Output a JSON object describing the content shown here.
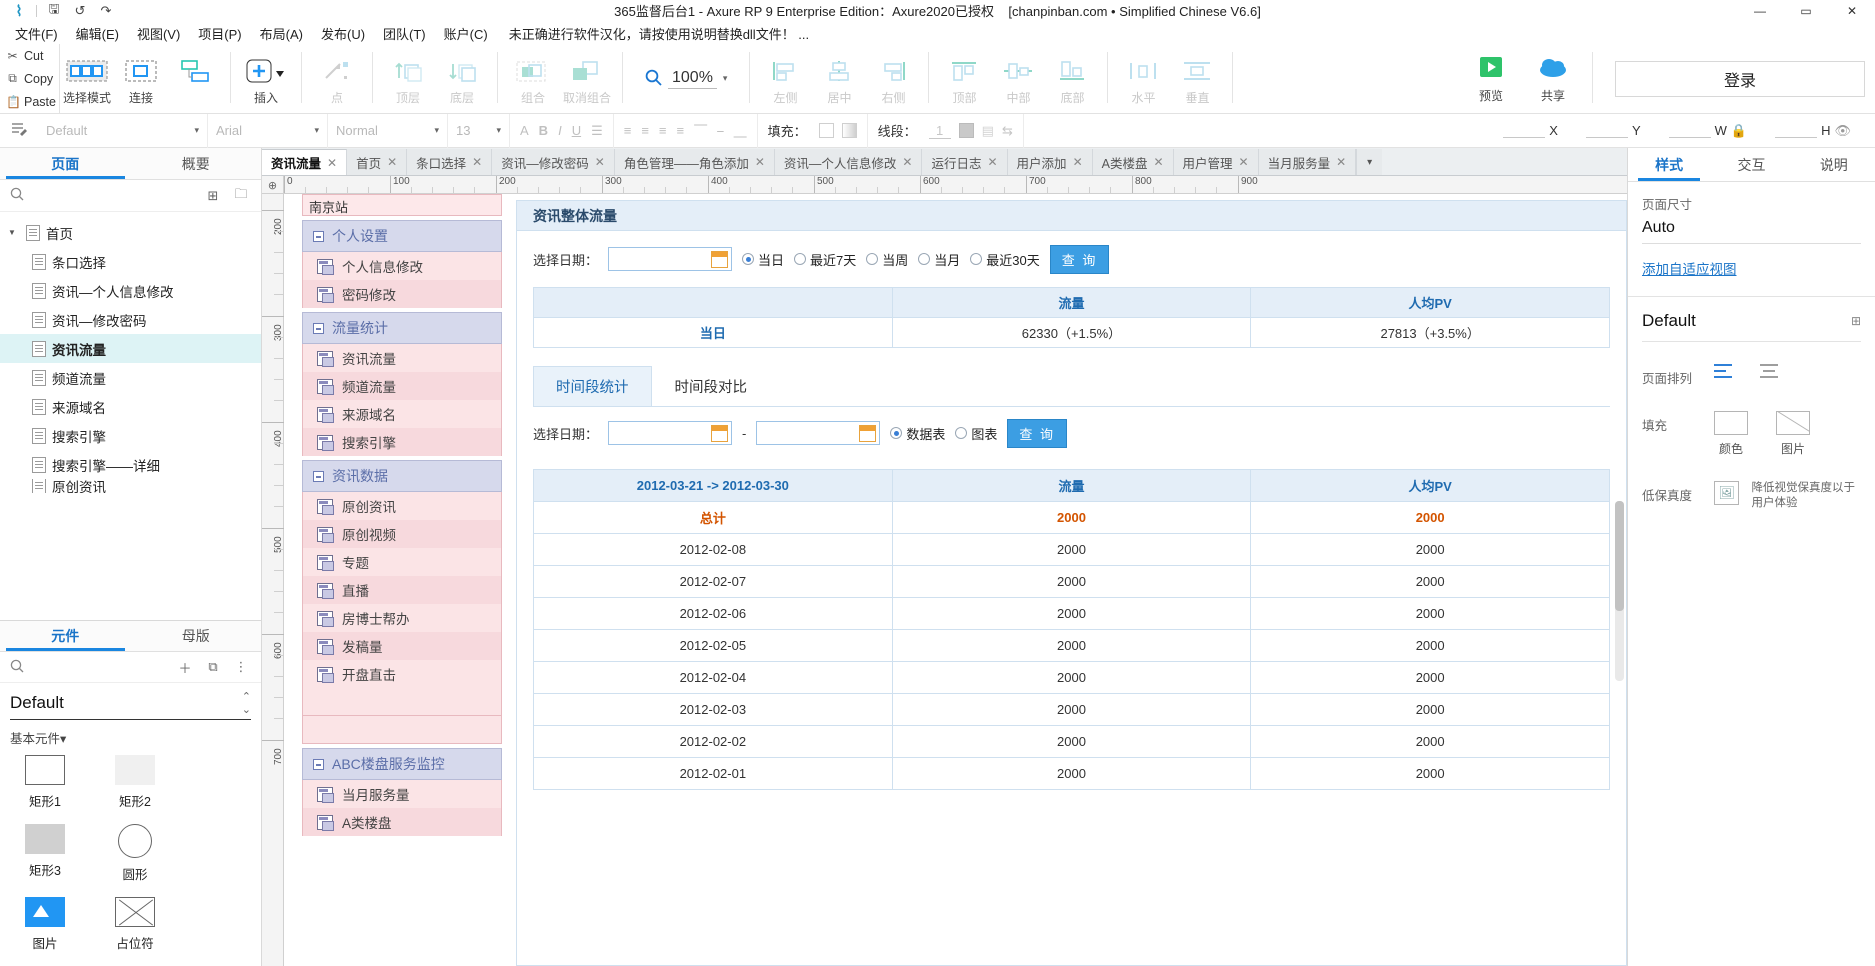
{
  "titlebar": {
    "title": "365监督后台1 - Axure RP 9 Enterprise Edition：Axure2020已授权",
    "subtitle": "[chanpinban.com • Simplified Chinese V6.6]",
    "minimize": "—",
    "maximize": "▭",
    "close": "✕",
    "icons": [
      "logo-x",
      "save-icon",
      "undo-icon",
      "redo-icon"
    ]
  },
  "menubar": {
    "items": [
      "文件(F)",
      "编辑(E)",
      "视图(V)",
      "项目(P)",
      "布局(A)",
      "发布(U)",
      "团队(T)",
      "账户(C)"
    ],
    "note": "未正确进行软件汉化，请按使用说明替换dll文件！ ..."
  },
  "clipboard": {
    "cut": "Cut",
    "copy": "Copy",
    "paste": "Paste"
  },
  "toolbar": {
    "items": [
      {
        "label": "选择模式",
        "name": "select-mode"
      },
      {
        "label": "连接",
        "name": "connect"
      },
      {
        "label": "插入",
        "name": "insert"
      },
      {
        "label": "点",
        "name": "point"
      },
      {
        "label": "顶层",
        "name": "bring-front"
      },
      {
        "label": "底层",
        "name": "send-back"
      },
      {
        "label": "组合",
        "name": "group"
      },
      {
        "label": "取消组合",
        "name": "ungroup"
      },
      {
        "label": "左侧",
        "name": "align-left"
      },
      {
        "label": "居中",
        "name": "align-center"
      },
      {
        "label": "右侧",
        "name": "align-right"
      },
      {
        "label": "顶部",
        "name": "align-top"
      },
      {
        "label": "中部",
        "name": "align-middle"
      },
      {
        "label": "底部",
        "name": "align-bottom"
      },
      {
        "label": "水平",
        "name": "distribute-horizontal"
      },
      {
        "label": "垂直",
        "name": "distribute-vertical"
      }
    ],
    "zoom": "100%",
    "preview": "预览",
    "share": "共享",
    "login": "登录"
  },
  "formatbar": {
    "style": "Default",
    "font": "Arial",
    "weight": "Normal",
    "size": "13",
    "fill_label": "填充：",
    "line_label": "线段：",
    "line_width": "1",
    "x_label": "X",
    "y_label": "Y",
    "w_label": "W",
    "h_label": "H"
  },
  "left_panel": {
    "tabs": [
      {
        "label": "页面",
        "active": true
      },
      {
        "label": "概要",
        "active": false
      }
    ],
    "search_placeholder": "",
    "tree": [
      {
        "label": "首页",
        "level": 0,
        "expanded": true,
        "selected": false
      },
      {
        "label": "条口选择",
        "level": 1,
        "selected": false
      },
      {
        "label": "资讯—个人信息修改",
        "level": 1,
        "selected": false
      },
      {
        "label": "资讯—修改密码",
        "level": 1,
        "selected": false
      },
      {
        "label": "资讯流量",
        "level": 1,
        "selected": true
      },
      {
        "label": "频道流量",
        "level": 1,
        "selected": false
      },
      {
        "label": "来源域名",
        "level": 1,
        "selected": false
      },
      {
        "label": "搜索引擎",
        "level": 1,
        "selected": false
      },
      {
        "label": "搜索引擎——详细",
        "level": 1,
        "selected": false
      },
      {
        "label": "原创资讯",
        "level": 1,
        "selected": false
      }
    ]
  },
  "library_panel": {
    "tabs": [
      {
        "label": "元件",
        "active": true
      },
      {
        "label": "母版",
        "active": false
      }
    ],
    "selected_library": "Default",
    "category": "基本元件",
    "items": [
      {
        "label": "矩形1",
        "shape": "rect-outline"
      },
      {
        "label": "矩形2",
        "shape": "rect-light"
      },
      {
        "label": "矩形3",
        "shape": "rect-gray"
      },
      {
        "label": "圆形",
        "shape": "circle"
      },
      {
        "label": "图片",
        "shape": "image"
      },
      {
        "label": "占位符",
        "shape": "placeholder"
      }
    ]
  },
  "tabbar": {
    "tabs": [
      {
        "label": "资讯流量",
        "active": true
      },
      {
        "label": "首页",
        "active": false
      },
      {
        "label": "条口选择",
        "active": false
      },
      {
        "label": "资讯—修改密码",
        "active": false
      },
      {
        "label": "角色管理——角色添加",
        "active": false
      },
      {
        "label": "资讯—个人信息修改",
        "active": false
      },
      {
        "label": "运行日志",
        "active": false
      },
      {
        "label": "用户添加",
        "active": false
      },
      {
        "label": "A类楼盘",
        "active": false
      },
      {
        "label": "用户管理",
        "active": false
      },
      {
        "label": "当月服务量",
        "active": false
      }
    ],
    "more": "▾"
  },
  "rulers": {
    "horizontal": [
      "0",
      "100",
      "200",
      "300",
      "400",
      "500",
      "600",
      "700",
      "800",
      "900"
    ],
    "vertical": [
      "200",
      "300",
      "400",
      "500",
      "600",
      "700"
    ]
  },
  "prototype_nav": {
    "site_label": "南京站",
    "groups": [
      {
        "title": "个人设置",
        "items": [
          "个人信息修改",
          "密码修改"
        ]
      },
      {
        "title": "流量统计",
        "items": [
          "资讯流量",
          "频道流量",
          "来源域名",
          "搜索引擎"
        ]
      },
      {
        "title": "资讯数据",
        "items": [
          "原创资讯",
          "原创视频",
          "专题",
          "直播",
          "房博士帮办",
          "发稿量",
          "开盘直击"
        ]
      },
      {
        "title": "ABC楼盘服务监控",
        "items": [
          "当月服务量",
          "A类楼盘"
        ]
      }
    ]
  },
  "report": {
    "title": "资讯整体流量",
    "filter": {
      "date_label": "选择日期：",
      "date_value": "",
      "radios": [
        {
          "label": "当日",
          "checked": true
        },
        {
          "label": "最近7天",
          "checked": false
        },
        {
          "label": "当周",
          "checked": false
        },
        {
          "label": "当月",
          "checked": false
        },
        {
          "label": "最近30天",
          "checked": false
        }
      ],
      "query_button": "查 询"
    },
    "summary_table": {
      "headers": [
        "",
        "流量",
        "人均PV"
      ],
      "rows": [
        [
          "当日",
          "62330（+1.5%）",
          "27813（+3.5%）"
        ]
      ]
    },
    "subtabs": [
      {
        "label": "时间段统计",
        "active": true
      },
      {
        "label": "时间段对比",
        "active": false
      }
    ],
    "detail_filter": {
      "date_label": "选择日期：",
      "date_from": "",
      "date_to": "",
      "separator": "-",
      "radios": [
        {
          "label": "数据表",
          "checked": true
        },
        {
          "label": "图表",
          "checked": false
        }
      ],
      "query_button": "查 询"
    },
    "detail_table": {
      "headers": [
        "2012-03-21 -> 2012-03-30",
        "流量",
        "人均PV"
      ],
      "total_row": [
        "总计",
        "2000",
        "2000"
      ],
      "rows": [
        [
          "2012-02-08",
          "2000",
          "2000"
        ],
        [
          "2012-02-07",
          "2000",
          "2000"
        ],
        [
          "2012-02-06",
          "2000",
          "2000"
        ],
        [
          "2012-02-05",
          "2000",
          "2000"
        ],
        [
          "2012-02-04",
          "2000",
          "2000"
        ],
        [
          "2012-02-03",
          "2000",
          "2000"
        ],
        [
          "2012-02-02",
          "2000",
          "2000"
        ],
        [
          "2012-02-01",
          "2000",
          "2000"
        ]
      ]
    }
  },
  "right_panel": {
    "tabs": [
      {
        "label": "样式",
        "active": true
      },
      {
        "label": "交互",
        "active": false
      },
      {
        "label": "说明",
        "active": false
      }
    ],
    "page_size_label": "页面尺寸",
    "page_size_value": "Auto",
    "adaptive_link": "添加自适应视图",
    "style_name": "Default",
    "page_align_label": "页面排列",
    "fill_label": "填充",
    "fill_color_label": "颜色",
    "fill_image_label": "图片",
    "fidelity_label": "低保真度",
    "fidelity_note": "降低视觉保真度以于用户体验"
  },
  "colors": {
    "accent": "#1a86e0",
    "panel_header": "#e4eef8",
    "table_header_text": "#1f6bb0",
    "total_text": "#d35400",
    "delta_text": "#c0392b",
    "selection": "#ddf3f5"
  }
}
